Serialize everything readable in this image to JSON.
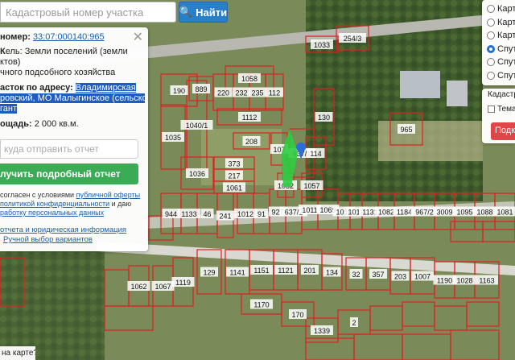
{
  "search": {
    "placeholder": "Кадастровый номер участка",
    "button_label": "Найти"
  },
  "info": {
    "cadnum_label": "номер:",
    "cadnum_value": "33:07:000140:965",
    "category_line1": "ель: Земли поселений (земли",
    "category_line2": "ктов)",
    "usage_line": "чного подсобного хозяйства",
    "address_label": "асток по адресу:",
    "address_line1": "Владимирская",
    "address_line2": "ровский, МО Малыгинское (сельское",
    "address_line3": "гант",
    "area_label": "ощадь:",
    "area_value": "2 000 кв.м.",
    "email_placeholder": "куда отправить отчет",
    "report_button": "лучить подробный отчет",
    "agree_line1": "согласен с условиями",
    "agree_link1": "публичной оферты",
    "agree_line2a": "политикой конфиденциальности",
    "agree_line2b": " и даю",
    "agree_line3": "работку персональных данных",
    "link_sample": "отчета и юридическая информация",
    "link_manual": "Ручной выбор вариантов"
  },
  "layers": {
    "options": [
      "Карт",
      "Карта",
      "Карта",
      "Спут",
      "Спут",
      "Спут"
    ],
    "selected_index": 3
  },
  "cadastre": {
    "label": "Кадастров",
    "checkbox_label": "Тема",
    "button_label": "Подк"
  },
  "bottom_text": "на карте?",
  "map": {
    "parcels": [
      "1033",
      "254/3",
      "1058",
      "190",
      "889",
      "220",
      "232",
      "235",
      "112",
      "1112",
      "130",
      "1035",
      "1040/1",
      "208",
      "107",
      "637/1",
      "114",
      "1036",
      "373",
      "217",
      "1061",
      "1032",
      "1057",
      "965",
      "944",
      "1133",
      "46",
      "241",
      "1012",
      "91",
      "927",
      "637/2",
      "1011",
      "1069",
      "1016",
      "1013",
      "1131",
      "1082",
      "1184",
      "967/2",
      "3009",
      "1095",
      "1088",
      "1081",
      "1062",
      "1067",
      "1119",
      "129",
      "1141",
      "1151",
      "1121",
      "201",
      "134",
      "32",
      "357",
      "203",
      "1007",
      "1190",
      "1028",
      "1163",
      "1170",
      "170",
      "1339",
      "2"
    ],
    "accent_color": "#e02020",
    "marker_color": "#2ecc40"
  }
}
